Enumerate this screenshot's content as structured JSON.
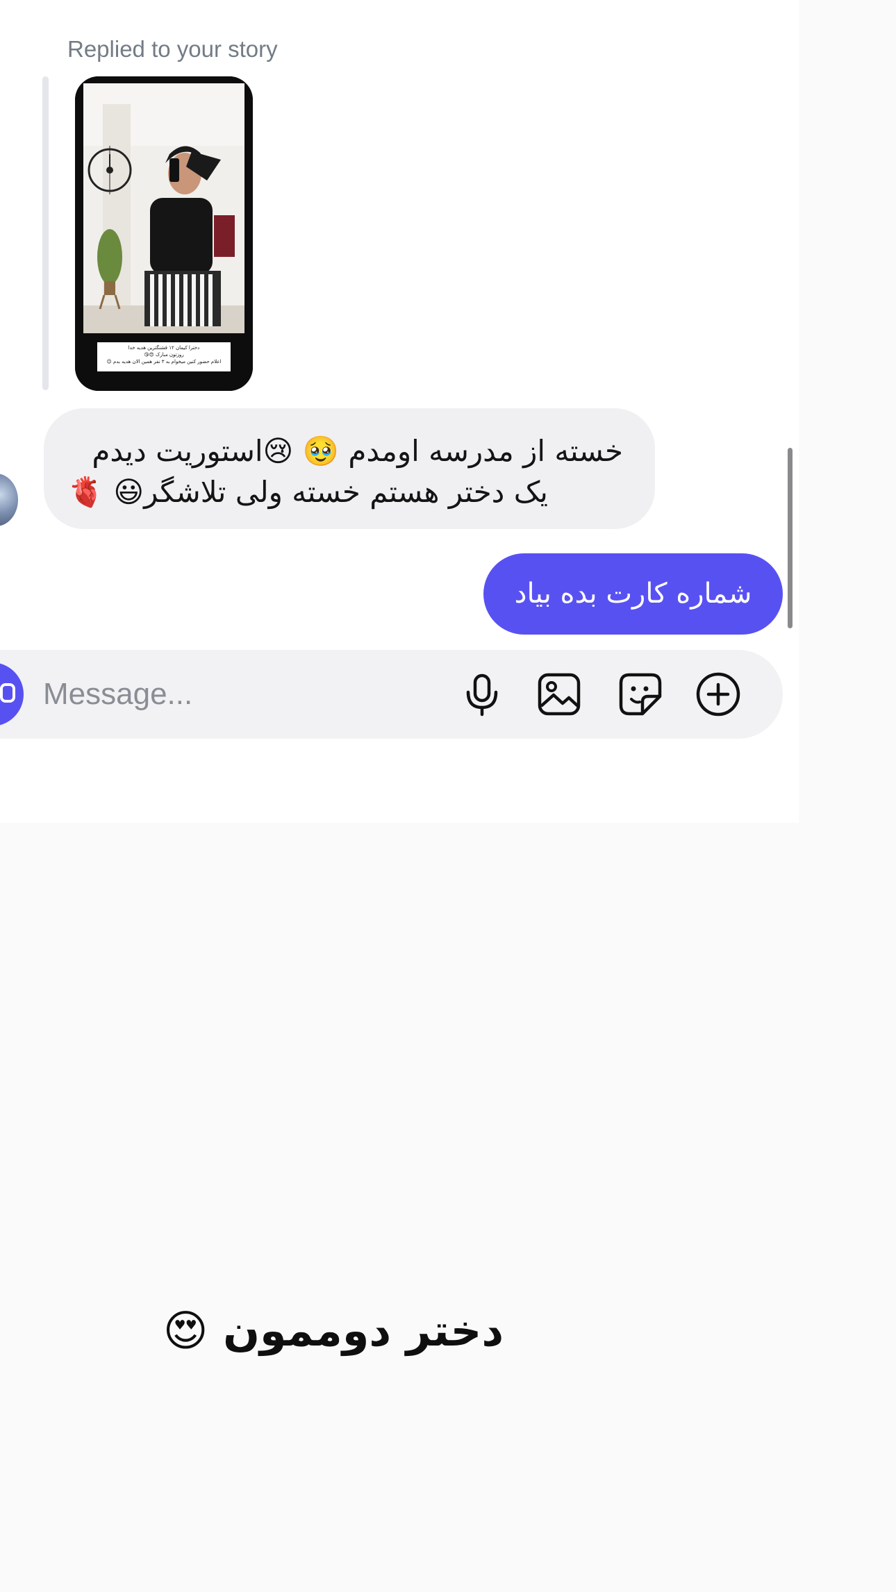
{
  "conversation": {
    "reply_label": "Replied to your story",
    "story_preview": {
      "caption_lines": [
        "دخترا کیمان ۱۲ قشنگترین هدیه خدا",
        "روزتون مبارک 😍😘",
        "اعلام حضور کنین میخوام به ۳ نفر همین الان هدیه بدم 😉"
      ]
    },
    "incoming_message": {
      "line1": "خسته از مدرسه اومدم 🥹 😢استوریت دیدم",
      "line2": "یک دختر هستم خسته ولی تلاشگر😃 🫀"
    },
    "outgoing_message": "شماره کارت بده بیاد"
  },
  "composer": {
    "placeholder": "Message...",
    "icons": [
      "camera-icon",
      "microphone-icon",
      "image-icon",
      "sticker-icon",
      "add-icon"
    ]
  },
  "overlay_caption": "دختر دوممون 😍",
  "colors": {
    "accent": "#5851f2",
    "incoming_bubble": "#f0f0f3",
    "composer_bg": "#f2f2f4",
    "page_bg": "#fafafa",
    "label_gray": "#737b86"
  }
}
